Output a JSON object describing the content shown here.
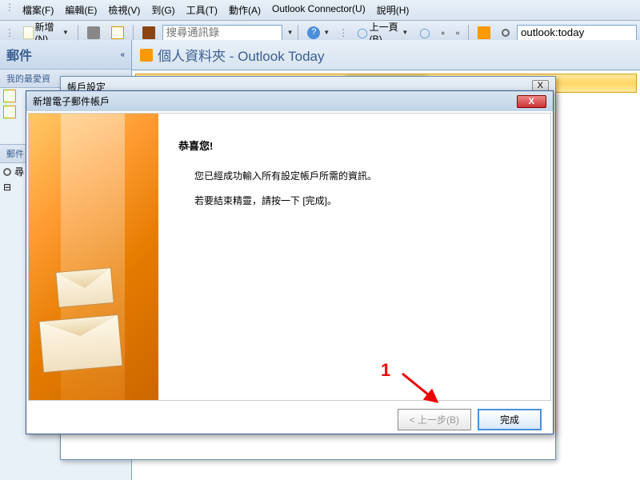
{
  "menu": {
    "file": "檔案(F)",
    "edit": "編輯(E)",
    "view": "檢視(V)",
    "go": "到(G)",
    "tools": "工具(T)",
    "actions": "動作(A)",
    "connector": "Outlook Connector(U)",
    "help": "說明(H)"
  },
  "toolbar": {
    "new_label": "新增(N)",
    "search_placeholder": "搜尋通訊錄",
    "back_label": "上一頁(B)",
    "address_value": "outlook:today"
  },
  "nav": {
    "header": "郵件",
    "favorites": "我的最愛資",
    "folders": "郵件",
    "item_search": "尋"
  },
  "content": {
    "title": "個人資料夾 - Outlook Today"
  },
  "dialog_bg": {
    "title": "帳戶設定"
  },
  "wizard": {
    "title": "新增電子郵件帳戶",
    "heading": "恭喜您!",
    "line1": "您已經成功輸入所有設定帳戶所需的資訊。",
    "line2": "若要結束精靈，請按一下 [完成]。",
    "back_btn": "< 上一步(B)",
    "finish_btn": "完成"
  },
  "annotation": {
    "num": "1"
  }
}
